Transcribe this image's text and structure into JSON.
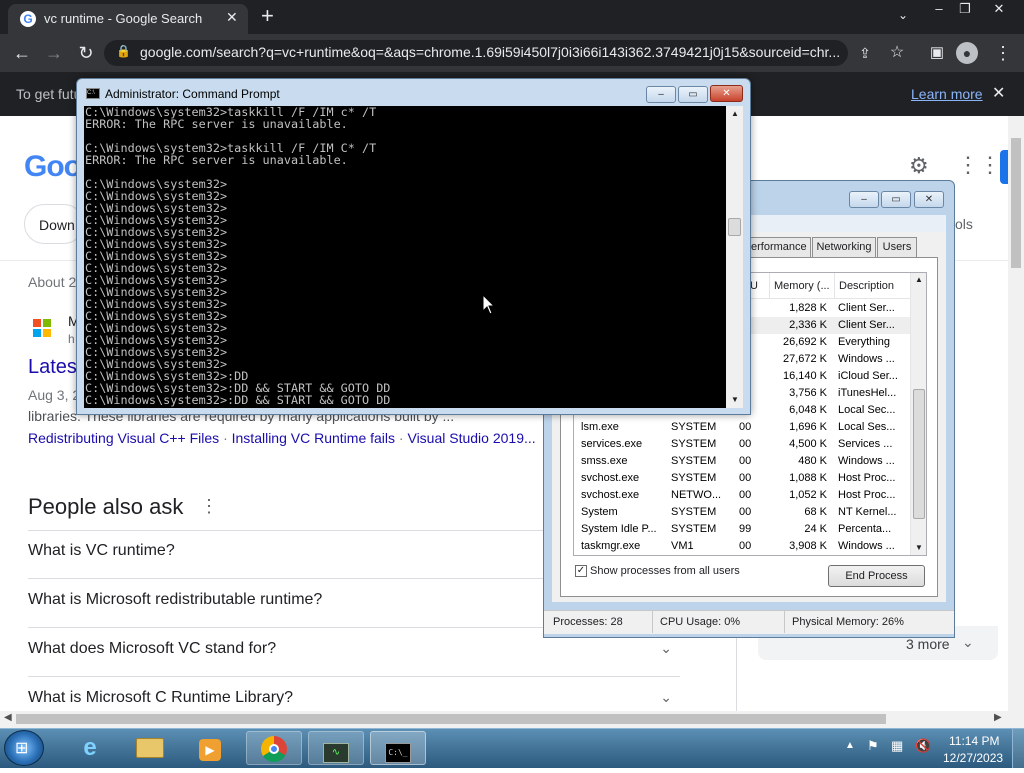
{
  "browser": {
    "tab_title": "vc runtime - Google Search",
    "new_tab": "+",
    "url": "google.com/search?q=vc+runtime&oq=&aqs=chrome.1.69i59i450l7j0i3i66i143i362.3749421j0j15&sourceid=chr...",
    "infobar_text": "To get futu",
    "infobar_link": "Learn more"
  },
  "google": {
    "logo_text": "Goog",
    "filter_chip": "Down",
    "filter_tools": "ols",
    "about": "About 2",
    "result_site_initial": "M",
    "result_site_sub": "h",
    "result_title": "Lates",
    "result_snippet_1": "Aug 3, 2",
    "result_snippet_2": "libraries. These libraries are required by many applications built by ...",
    "result_links": [
      "Redistributing Visual C++ Files",
      "Installing VC Runtime fails",
      "Visual Studio 2019..."
    ],
    "result_link_sep": "·",
    "paa_title": "People also ask",
    "paa_questions": [
      "What is VC runtime?",
      "What is Microsoft redistributable runtime?",
      "What does Microsoft VC stand for?",
      "What is Microsoft C Runtime Library?"
    ],
    "more_text": "3 more"
  },
  "cmd": {
    "title": "Administrator: Command Prompt",
    "lines": [
      "C:\\Windows\\system32>taskkill /F /IM c* /T",
      "ERROR: The RPC server is unavailable.",
      "",
      "C:\\Windows\\system32>taskkill /F /IM C* /T",
      "ERROR: The RPC server is unavailable.",
      "",
      "C:\\Windows\\system32>",
      "C:\\Windows\\system32>",
      "C:\\Windows\\system32>",
      "C:\\Windows\\system32>",
      "C:\\Windows\\system32>",
      "C:\\Windows\\system32>",
      "C:\\Windows\\system32>",
      "C:\\Windows\\system32>",
      "C:\\Windows\\system32>",
      "C:\\Windows\\system32>",
      "C:\\Windows\\system32>",
      "C:\\Windows\\system32>",
      "C:\\Windows\\system32>",
      "C:\\Windows\\system32>",
      "C:\\Windows\\system32>",
      "C:\\Windows\\system32>",
      "C:\\Windows\\system32>:DD",
      "C:\\Windows\\system32>:DD && START && GOTO DD",
      "C:\\Windows\\system32>:DD && START && GOTO DD"
    ]
  },
  "taskmgr": {
    "tabs": [
      "erformance",
      "Networking",
      "Users"
    ],
    "col_cpu": "U",
    "col_memory": "Memory (...",
    "col_description": "Description",
    "rows": [
      {
        "name": "",
        "user": "",
        "cpu": "",
        "mem": "1,828 K",
        "desc": "Client Ser..."
      },
      {
        "name": "",
        "user": "",
        "cpu": "",
        "mem": "2,336 K",
        "desc": "Client Ser..."
      },
      {
        "name": "",
        "user": "",
        "cpu": "",
        "mem": "26,692 K",
        "desc": "Everything"
      },
      {
        "name": "",
        "user": "",
        "cpu": "",
        "mem": "27,672 K",
        "desc": "Windows ..."
      },
      {
        "name": "",
        "user": "",
        "cpu": "",
        "mem": "16,140 K",
        "desc": "iCloud Ser..."
      },
      {
        "name": "",
        "user": "",
        "cpu": "",
        "mem": "3,756 K",
        "desc": "iTunesHel..."
      },
      {
        "name": "",
        "user": "",
        "cpu": "",
        "mem": "6,048 K",
        "desc": "Local Sec..."
      },
      {
        "name": "lsm.exe",
        "user": "SYSTEM",
        "cpu": "00",
        "mem": "1,696 K",
        "desc": "Local Ses..."
      },
      {
        "name": "services.exe",
        "user": "SYSTEM",
        "cpu": "00",
        "mem": "4,500 K",
        "desc": "Services ..."
      },
      {
        "name": "smss.exe",
        "user": "SYSTEM",
        "cpu": "00",
        "mem": "480 K",
        "desc": "Windows ..."
      },
      {
        "name": "svchost.exe",
        "user": "SYSTEM",
        "cpu": "00",
        "mem": "1,088 K",
        "desc": "Host Proc..."
      },
      {
        "name": "svchost.exe",
        "user": "NETWO...",
        "cpu": "00",
        "mem": "1,052 K",
        "desc": "Host Proc..."
      },
      {
        "name": "System",
        "user": "SYSTEM",
        "cpu": "00",
        "mem": "68 K",
        "desc": "NT Kernel..."
      },
      {
        "name": "System Idle P...",
        "user": "SYSTEM",
        "cpu": "99",
        "mem": "24 K",
        "desc": "Percenta..."
      },
      {
        "name": "taskmgr.exe",
        "user": "VM1",
        "cpu": "00",
        "mem": "3,908 K",
        "desc": "Windows ..."
      }
    ],
    "show_all_label": "Show processes from all users",
    "end_process": "End Process",
    "status_processes": "Processes: 28",
    "status_cpu": "CPU Usage: 0%",
    "status_memory": "Physical Memory: 26%"
  },
  "taskbar": {
    "time": "11:14 PM",
    "date": "12/27/2023"
  },
  "colors": {
    "chrome_dark": "#202124",
    "google_blue": "#1a0dab",
    "taskbar": "#2c5a7e",
    "cmd_bg": "#000000"
  }
}
